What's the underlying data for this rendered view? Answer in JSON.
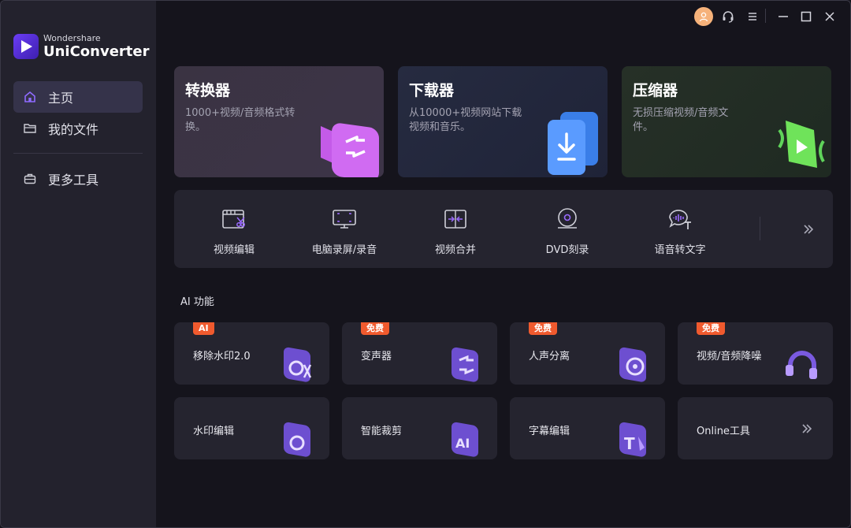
{
  "app": {
    "brand_small": "Wondershare",
    "brand_name": "UniConverter"
  },
  "colors": {
    "accent": "#7b4dff",
    "sidebar_bg": "#23222d",
    "badge": "#f05a2e"
  },
  "sidebar": {
    "items": [
      {
        "label": "主页",
        "icon": "home-icon",
        "active": true
      },
      {
        "label": "我的文件",
        "icon": "folder-icon",
        "active": false
      },
      {
        "label": "更多工具",
        "icon": "toolbox-icon",
        "active": false
      }
    ]
  },
  "feature_cards": [
    {
      "title": "转换器",
      "desc": "1000+视频/音频格式转换。",
      "icon": "converter-icon"
    },
    {
      "title": "下载器",
      "desc": "从10000+视频网站下载视频和音乐。",
      "icon": "downloader-icon"
    },
    {
      "title": "压缩器",
      "desc": "无损压缩视频/音频文件。",
      "icon": "compressor-icon"
    }
  ],
  "tools": [
    {
      "label": "视频编辑",
      "icon": "video-edit-icon"
    },
    {
      "label": "电脑录屏/录音",
      "icon": "screen-record-icon"
    },
    {
      "label": "视频合并",
      "icon": "video-merge-icon"
    },
    {
      "label": "DVD刻录",
      "icon": "dvd-burn-icon"
    },
    {
      "label": "语音转文字",
      "icon": "speech-to-text-icon"
    }
  ],
  "ai_section": {
    "title": "AI 功能",
    "cards": [
      {
        "label": "移除水印2.0",
        "badge": "AI",
        "icon": "remove-watermark-icon"
      },
      {
        "label": "变声器",
        "badge": "免费",
        "icon": "voice-changer-icon"
      },
      {
        "label": "人声分离",
        "badge": "免费",
        "icon": "vocal-remover-icon"
      },
      {
        "label": "视频/音频降噪",
        "badge": "免费",
        "icon": "noise-reduction-icon"
      },
      {
        "label": "水印编辑",
        "badge": "",
        "icon": "watermark-editor-icon"
      },
      {
        "label": "智能裁剪",
        "badge": "",
        "icon": "ai-crop-icon"
      },
      {
        "label": "字幕编辑",
        "badge": "",
        "icon": "subtitle-editor-icon"
      },
      {
        "label": "Online工具",
        "badge": "",
        "icon": "chevron-double-right-icon"
      }
    ]
  }
}
